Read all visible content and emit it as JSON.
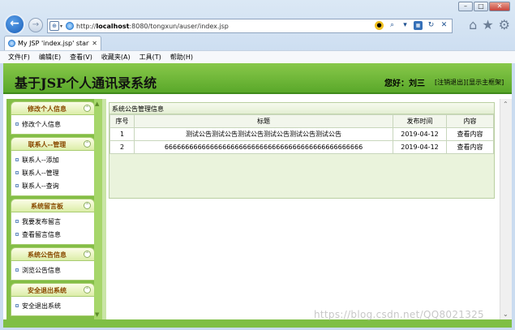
{
  "browser": {
    "address_scheme": "http://",
    "address_host": "localhost",
    "address_rest": ":8080/tongxun/auser/index.jsp",
    "tab_label": "My JSP 'index.jsp' startin...",
    "menu": [
      "文件(F)",
      "编辑(E)",
      "查看(V)",
      "收藏夹(A)",
      "工具(T)",
      "帮助(H)"
    ]
  },
  "header": {
    "title": "基于JSP个人通讯录系统",
    "greeting": "您好：刘三",
    "logout": "[注销退出]",
    "show_frame": "[显示主框架]"
  },
  "sidebar": {
    "groups": [
      {
        "title": "修改个人信息",
        "items": [
          "修改个人信息"
        ]
      },
      {
        "title": "联系人--管理",
        "items": [
          "联系人--添加",
          "联系人--管理",
          "联系人--查询"
        ]
      },
      {
        "title": "系统留言板",
        "items": [
          "我要发布留言",
          "查看留言信息"
        ]
      },
      {
        "title": "系统公告信息",
        "items": [
          "浏览公告信息"
        ]
      },
      {
        "title": "安全退出系统",
        "items": [
          "安全退出系统"
        ]
      }
    ]
  },
  "main": {
    "panel_title": "系统公告管理信息",
    "columns": [
      "序号",
      "标题",
      "发布时间",
      "内容"
    ],
    "rows": [
      {
        "no": "1",
        "title": "测试公告测试公告测试公告测试公告测试公告测试公告",
        "date": "2019-04-12",
        "action": "查看内容"
      },
      {
        "no": "2",
        "title": "666666666666666666666666666666666666666666666666",
        "date": "2019-04-12",
        "action": "查看内容"
      }
    ]
  },
  "watermark": "https://blog.csdn.net/QQ8021325"
}
